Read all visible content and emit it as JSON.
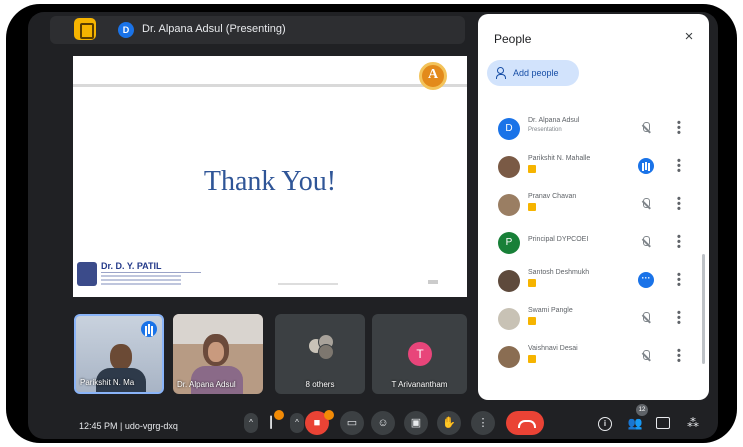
{
  "presenter": {
    "initial": "D",
    "label": "Dr. Alpana Adsul (Presenting)"
  },
  "slide": {
    "badge_letter": "A",
    "title": "Thank You!",
    "college_name": "Dr. D. Y. PATIL"
  },
  "tiles": [
    {
      "label": "Parikshit N. Ma"
    },
    {
      "label": "Dr. Alpana Adsul"
    },
    {
      "label": "8 others"
    },
    {
      "initial": "T",
      "label": "T Arivanantham"
    }
  ],
  "people_panel": {
    "title": "People",
    "close_glyph": "×",
    "add_people_label": "Add people",
    "participants": [
      {
        "name": "Dr. Alpana Adsul",
        "sub": "Presentation",
        "initial": "D",
        "avatar_color": "#1a73e8",
        "mic": "muted"
      },
      {
        "name": "Parikshit N. Mahalle",
        "sub": "",
        "mic": "speaking"
      },
      {
        "name": "Pranav Chavan",
        "sub": "",
        "mic": "muted"
      },
      {
        "name": "Principal DYPCOEI",
        "sub": "",
        "initial": "P",
        "avatar_color": "#188038",
        "mic": "muted"
      },
      {
        "name": "Santosh Deshmukh",
        "sub": "",
        "mic": "active"
      },
      {
        "name": "Swami Pangle",
        "sub": "",
        "mic": "muted"
      },
      {
        "name": "Vaishnavi Desai",
        "sub": "",
        "mic": "muted"
      }
    ]
  },
  "bottom_bar": {
    "time_code": "12:45 PM | udo-vgrg-dxq",
    "people_count": "12",
    "info_glyph": "i"
  },
  "colors": {
    "background": "#202124",
    "panel": "#ffffff",
    "accent_blue": "#1a73e8",
    "end_call_red": "#ea4335",
    "slide_title": "#2f5597"
  }
}
